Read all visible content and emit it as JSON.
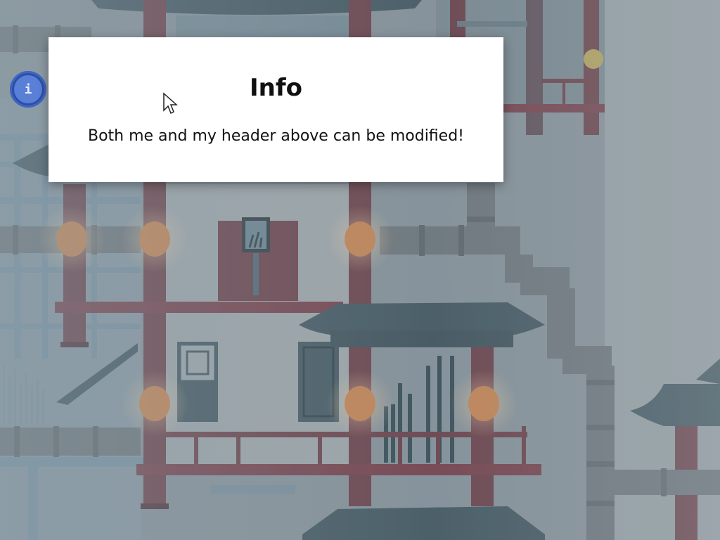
{
  "dialog": {
    "title": "Info",
    "message": "Both me and my header above can be modified!"
  },
  "info_button": {
    "icon": "info-icon",
    "label": "i"
  },
  "colors": {
    "sky": "#8e9aa3",
    "pillar": "#6e3a44",
    "roof": "#3e5560",
    "pipe": "#6f7a82",
    "lantern": "#d98a4e",
    "info_button": "#2c4fa8",
    "dialog_bg": "#ffffff"
  }
}
